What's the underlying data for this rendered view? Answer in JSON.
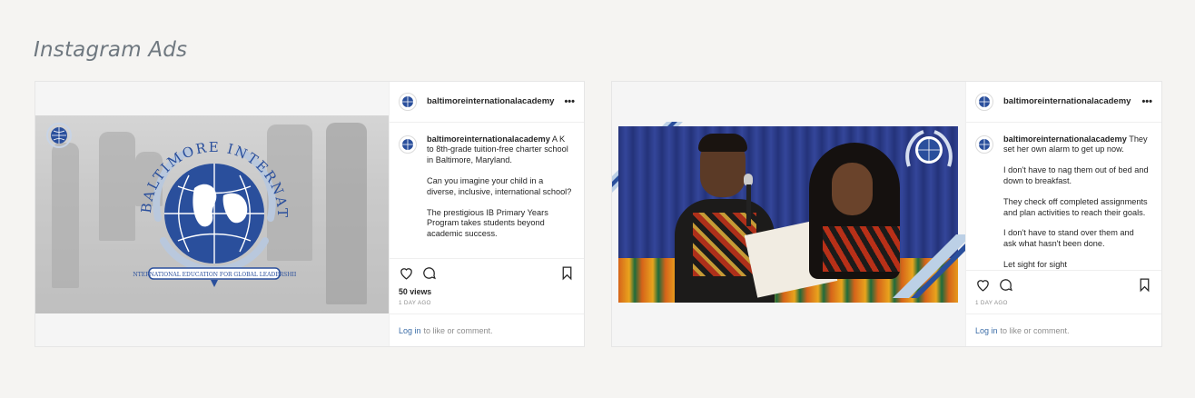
{
  "page": {
    "heading": "Instagram Ads"
  },
  "posts": [
    {
      "username": "baltimoreinternationalacademy",
      "more_icon": "more-dots-icon",
      "caption_lead": "A K to 8th-grade tuition-free charter school in Baltimore, Maryland.",
      "caption_paragraphs": [
        "Can you imagine your child in a diverse, inclusive, international school?",
        "The prestigious IB Primary Years Program takes students beyond academic success."
      ],
      "views": "50 views",
      "time_ago": "1 DAY AGO",
      "login_link": "Log in",
      "login_rest": "to like or comment.",
      "image": {
        "logo_top_text": "BALTIMORE INTERNATIONAL ACADEMY",
        "banner": "International Education for Global Leadership"
      }
    },
    {
      "username": "baltimoreinternationalacademy",
      "more_icon": "more-dots-icon",
      "caption_lead": "They set her own alarm to get up now.",
      "caption_paragraphs": [
        "I don't have to nag them out of bed and down to breakfast.",
        "They check off completed assignments and plan activities to reach their goals.",
        "I don't have to stand over them and ask what hasn't been done.",
        "Let sight for sight"
      ],
      "time_ago": "1 DAY AGO",
      "login_link": "Log in",
      "login_rest": "to like or comment."
    }
  ],
  "colors": {
    "accent_blue": "#2a4f9c",
    "link": "#3d6ea8",
    "background": "#f5f4f2"
  }
}
